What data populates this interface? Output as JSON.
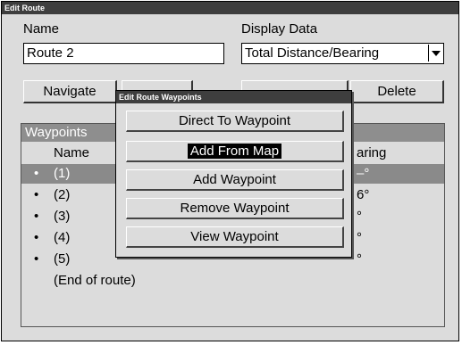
{
  "window": {
    "title": "Edit Route"
  },
  "name_label": "Name",
  "name_value": "Route 2",
  "display_label": "Display Data",
  "display_value": "Total Distance/Bearing",
  "buttons": {
    "navigate": "Navigate",
    "delete": "Delete"
  },
  "waypoints": {
    "header": "Waypoints",
    "col_name": "Name",
    "col_bearing": "aring",
    "rows": [
      {
        "name": "(1)",
        "bearing": "–°",
        "bullet": "•"
      },
      {
        "name": "(2)",
        "bearing": "6°",
        "bullet": "•"
      },
      {
        "name": "(3)",
        "bearing": "°",
        "bullet": "•"
      },
      {
        "name": "(4)",
        "bearing": "°",
        "bullet": "•"
      },
      {
        "name": "(5)",
        "bearing": "°",
        "bullet": "•"
      }
    ],
    "end": "(End of route)"
  },
  "popup": {
    "title": "Edit Route Waypoints",
    "items": [
      "Direct To Waypoint",
      "Add From Map",
      "Add Waypoint",
      "Remove Waypoint",
      "View Waypoint"
    ],
    "selected_index": 1
  }
}
